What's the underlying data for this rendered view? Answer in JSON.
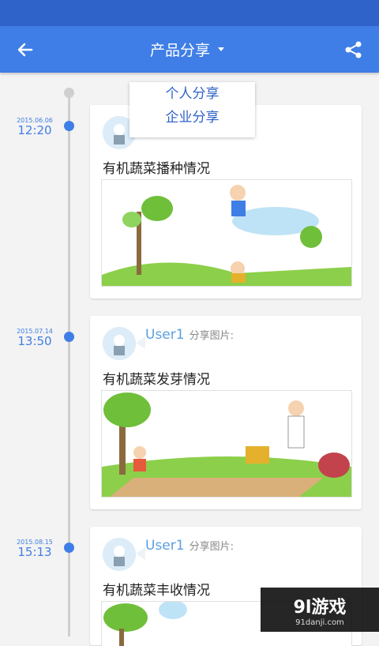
{
  "header": {
    "title": "产品分享",
    "back_icon": "arrow-left-icon",
    "share_icon": "share-icon"
  },
  "dropdown": {
    "items": [
      "个人分享",
      "企业分享"
    ]
  },
  "posts": [
    {
      "date": "2015.06.06",
      "time": "12:20",
      "user": "",
      "action": "",
      "text": "有机蔬菜播种情况"
    },
    {
      "date": "2015.07.14",
      "time": "13:50",
      "user": "User1",
      "action": "分享图片:",
      "text": "有机蔬菜发芽情况"
    },
    {
      "date": "2015.08.15",
      "time": "15:13",
      "user": "User1",
      "action": "分享图片:",
      "text": "有机蔬菜丰收情况"
    }
  ],
  "watermark": {
    "line1": "9l游戏",
    "line2": "91danji.com"
  },
  "colors": {
    "accent": "#3f7ee6",
    "statusbar": "#2f63c9"
  }
}
